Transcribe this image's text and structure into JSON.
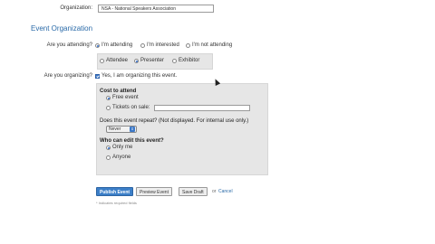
{
  "organization": {
    "label": "Organization:",
    "value": "NSA - National Speakers Association"
  },
  "section_title": "Event Organization",
  "attending": {
    "label": "Are you attending?",
    "options": [
      {
        "label": "I'm attending",
        "selected": true
      },
      {
        "label": "I'm interested",
        "selected": false
      },
      {
        "label": "I'm not attending",
        "selected": false
      }
    ],
    "role_options": [
      {
        "label": "Attendee",
        "selected": false
      },
      {
        "label": "Presenter",
        "selected": true
      },
      {
        "label": "Exhibitor",
        "selected": false
      }
    ]
  },
  "organizing": {
    "label": "Are you organizing?",
    "checkbox_label": "Yes, I am organizing this event.",
    "checked": true
  },
  "cost": {
    "title": "Cost to attend",
    "options": [
      {
        "label": "Free event",
        "selected": true
      },
      {
        "label": "Tickets on sale:",
        "selected": false
      }
    ],
    "tickets_value": ""
  },
  "repeat": {
    "title": "Does this event repeat? (Not displayed. For internal use only.)",
    "selected": "Never"
  },
  "edit": {
    "title": "Who can edit this event?",
    "options": [
      {
        "label": "Only me",
        "selected": true
      },
      {
        "label": "Anyone",
        "selected": false
      }
    ]
  },
  "actions": {
    "publish": "Publish Event",
    "preview": "Preview Event",
    "save": "Save Draft",
    "or": "or",
    "cancel": "Cancel"
  },
  "footnote": "* Indicates required fields",
  "colors": {
    "accent": "#2a6aa8",
    "primary_button": "#3c7fc8",
    "panel": "#e6e6e6"
  }
}
